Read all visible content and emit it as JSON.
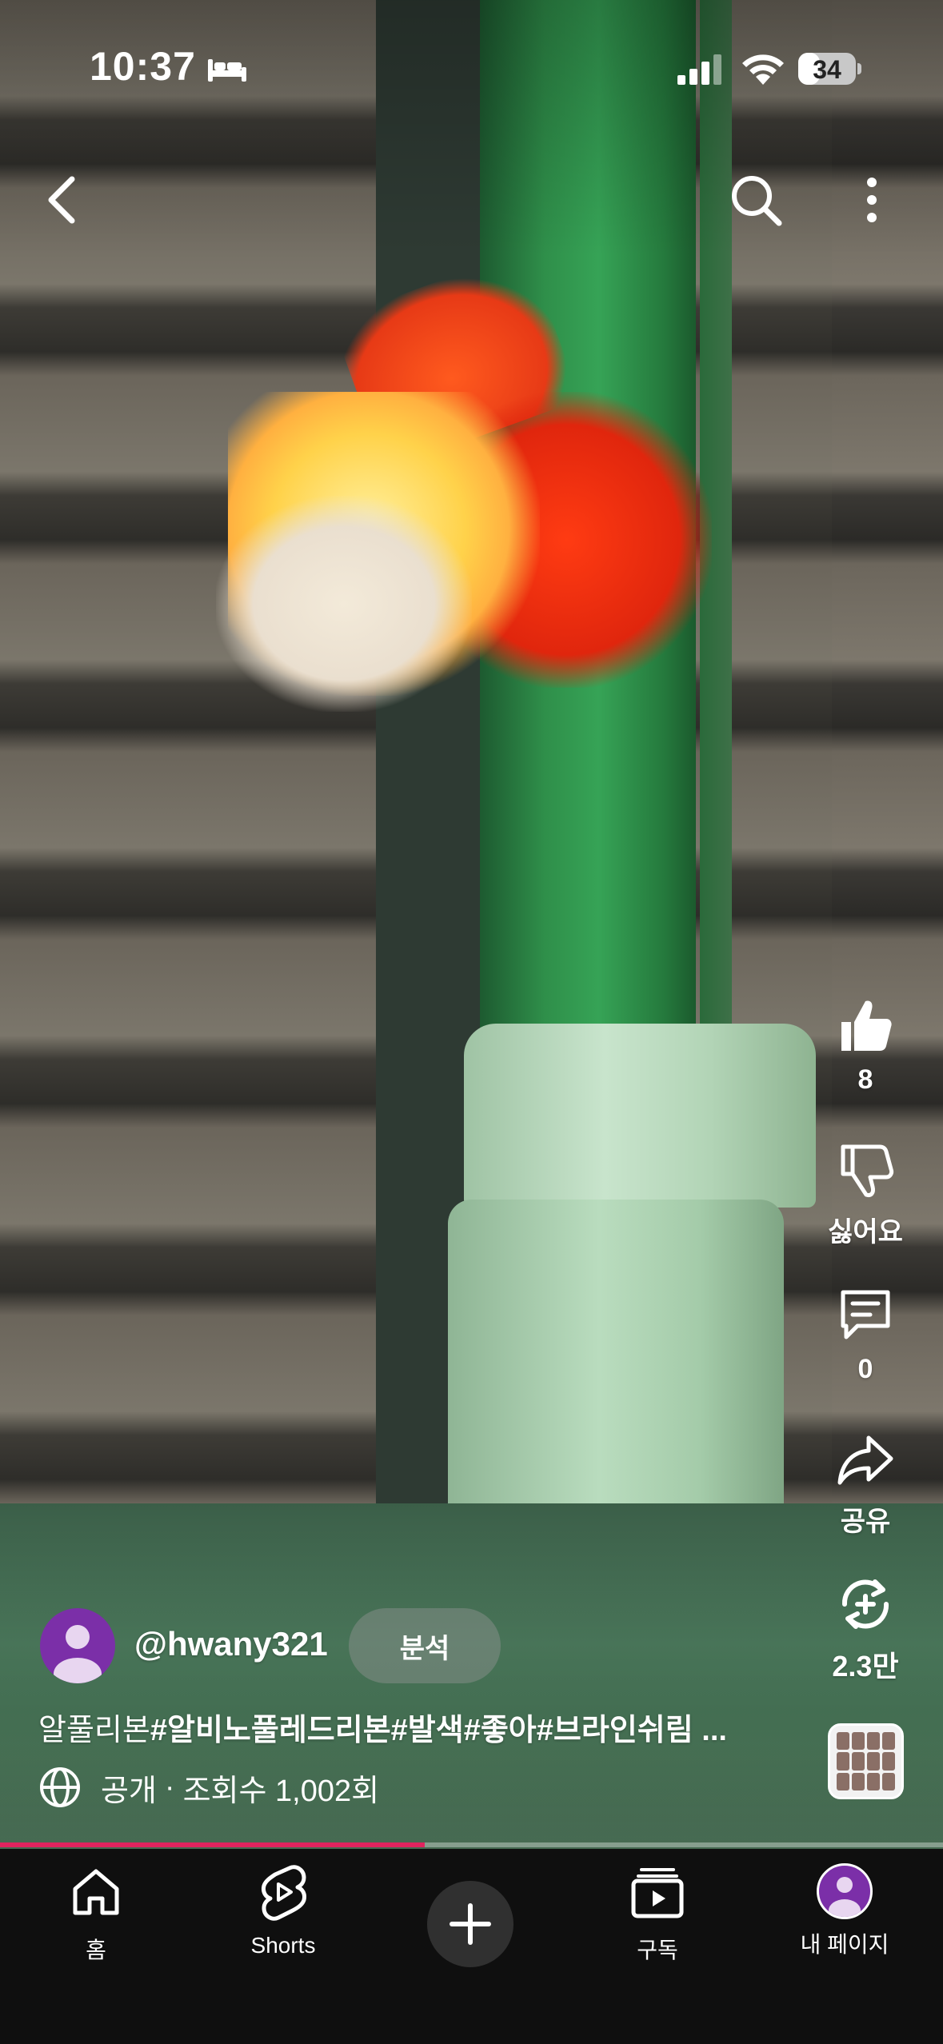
{
  "status_bar": {
    "time": "10:37",
    "battery_level": "34",
    "icons": [
      "bed-icon",
      "signal-icon",
      "wifi-icon",
      "battery-icon"
    ]
  },
  "top_bar": {
    "icons": [
      "back-icon",
      "search-icon",
      "more-vertical-icon"
    ]
  },
  "actions": {
    "like_count": "8",
    "dislike_label": "싫어요",
    "comment_count": "0",
    "share_label": "공유",
    "remix_count": "2.3만"
  },
  "channel": {
    "handle": "@hwany321",
    "analyze_button": "분석"
  },
  "video": {
    "title_plain": "알풀리본",
    "title_tags": "#알비노풀레드리본#발색#좋아#브라인쉬림 ...",
    "visibility": "공개",
    "separator": "·",
    "views": "조회수 1,002회",
    "progress": 0.45
  },
  "bottom_nav": {
    "home": "홈",
    "shorts": "Shorts",
    "subscriptions": "구독",
    "my_page": "내 페이지"
  },
  "colors": {
    "progress": "#e0245e",
    "avatar": "#7b2fa8",
    "nav_background": "#0f0f0f"
  }
}
